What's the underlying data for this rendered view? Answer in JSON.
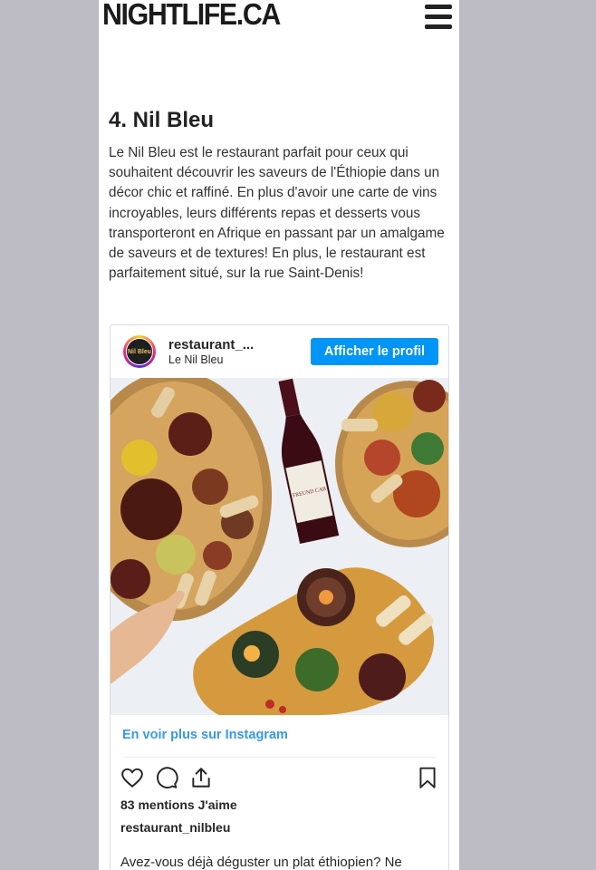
{
  "site": {
    "logo": "NIGHTLIFE.CA",
    "menu_icon": "hamburger-menu-icon"
  },
  "article": {
    "heading": "4. Nil Bleu",
    "paragraph": "Le Nil Bleu est le restaurant parfait pour ceux qui souhaitent découvrir les saveurs de l'Éthiopie dans un décor chic et raffiné. En plus d'avoir une carte de vins incroyables, leurs différents repas et desserts vous transporteront en Afrique en passant par un amalgame de saveurs et de textures! En plus, le restaurant est parfaitement situé, sur la rue Saint-Denis!"
  },
  "instagram": {
    "username": "restaurant_...",
    "full_name": "Le Nil Bleu",
    "avatar_text": "Nil Bleu",
    "profile_button": "Afficher le profil",
    "photo_label": "FREUND CAB",
    "more_link": "En voir plus sur Instagram",
    "icons": [
      "heart-icon",
      "comment-icon",
      "share-icon",
      "bookmark-icon"
    ],
    "likes": "83 mentions J'aime",
    "owner": "restaurant_nilbleu",
    "caption": "Avez-vous déjà déguster un plat éthiopien? Ne"
  },
  "colors": {
    "accent": "#0095f6",
    "link": "#3897f0",
    "background": "#bdbcc4"
  }
}
